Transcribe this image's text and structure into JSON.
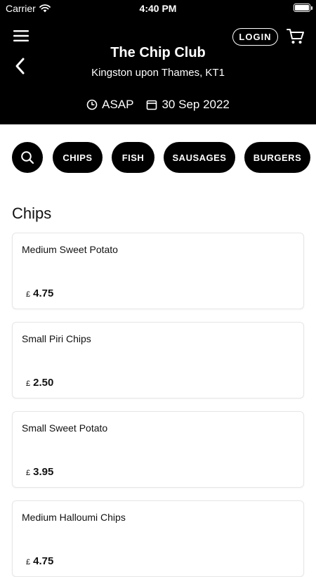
{
  "status_bar": {
    "carrier": "Carrier",
    "time": "4:40 PM"
  },
  "header": {
    "login_label": "LOGIN",
    "title": "The Chip Club",
    "location": "Kingston upon Thames, KT1",
    "time_option": "ASAP",
    "date": "30 Sep 2022"
  },
  "categories": [
    "CHIPS",
    "FISH",
    "SAUSAGES",
    "BURGERS"
  ],
  "section": {
    "title": "Chips",
    "items": [
      {
        "name": "Medium Sweet Potato",
        "currency": "£",
        "price": "4.75"
      },
      {
        "name": "Small Piri Chips",
        "currency": "£",
        "price": "2.50"
      },
      {
        "name": "Small Sweet Potato",
        "currency": "£",
        "price": "3.95"
      },
      {
        "name": "Medium Halloumi Chips",
        "currency": "£",
        "price": "4.75"
      }
    ]
  },
  "icons": [
    "wifi-icon",
    "battery-icon",
    "menu-icon",
    "back-icon",
    "cart-icon",
    "clock-icon",
    "calendar-icon",
    "search-icon"
  ],
  "colors": {
    "header_bg": "#000000",
    "chip_bg": "#000000",
    "text_on_dark": "#ffffff",
    "card_border": "#e6e6e6"
  }
}
